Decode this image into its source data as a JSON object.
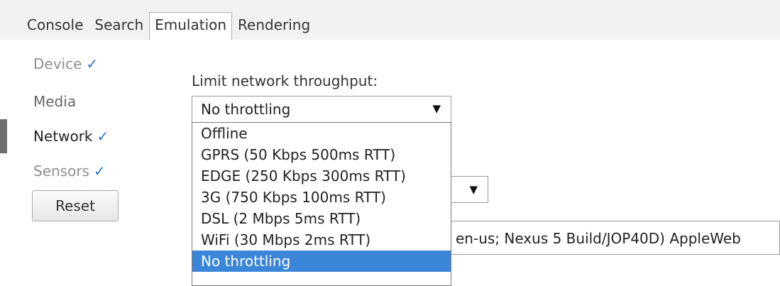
{
  "tabs": [
    {
      "label": "Console",
      "active": false
    },
    {
      "label": "Search",
      "active": false
    },
    {
      "label": "Emulation",
      "active": true
    },
    {
      "label": "Rendering",
      "active": false
    }
  ],
  "sidebar": {
    "items": [
      {
        "label": "Device",
        "checked": true,
        "check": "✓"
      },
      {
        "label": "Media",
        "checked": false
      },
      {
        "label": "Network",
        "checked": true,
        "check": "✓"
      },
      {
        "label": "Sensors",
        "checked": true,
        "check": "✓"
      }
    ],
    "reset_label": "Reset"
  },
  "network": {
    "label": "Limit network throughput:",
    "selected": "No throttling",
    "options": [
      "Offline",
      "GPRS (50 Kbps 500ms RTT)",
      "EDGE (250 Kbps 300ms RTT)",
      "3G (750 Kbps 100ms RTT)",
      "DSL (2 Mbps 5ms RTT)",
      "WiFi (30 Mbps 2ms RTT)",
      "No throttling"
    ]
  },
  "user_agent": {
    "value": "en-us; Nexus 5 Build/JOP40D) AppleWeb"
  },
  "icons": {
    "dropdown_arrow": "▼",
    "check": "✓"
  },
  "colors": {
    "accent": "#3b86d8",
    "check": "#2a6fd6"
  }
}
